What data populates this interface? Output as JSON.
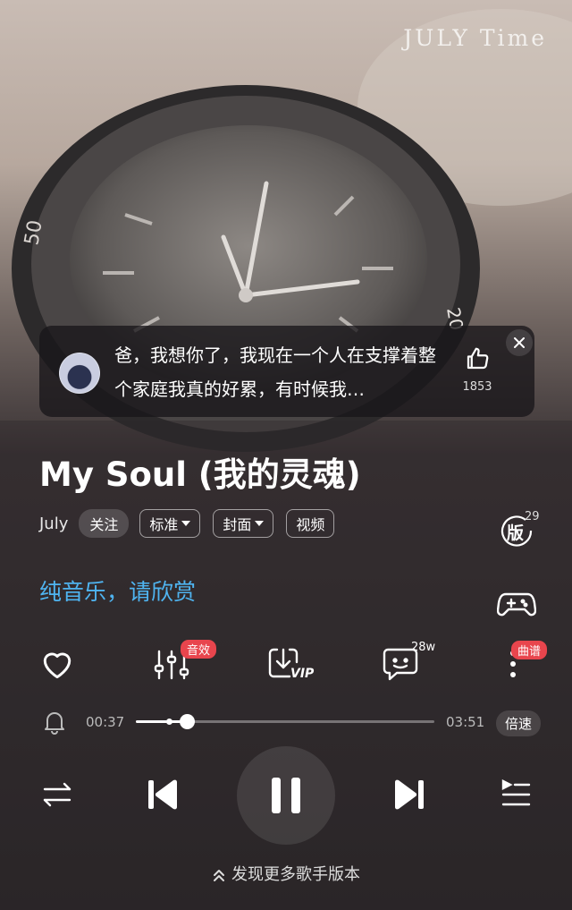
{
  "watermark": "JULY Time",
  "comment": {
    "text": "爸，我想你了，我现在一个人在支撑着整个家庭我真的好累，有时候我…",
    "like_count": "1853"
  },
  "song": {
    "title": "My Soul (我的灵魂)",
    "artist": "July",
    "follow_label": "关注",
    "chips": [
      "标准",
      "封面",
      "视频"
    ],
    "version_count": "29",
    "version_label": "版",
    "lyric": "纯音乐，请欣赏"
  },
  "actions": {
    "effects_badge": "音效",
    "comments_count": "28w",
    "score_badge": "曲谱",
    "vip_label": "VIP"
  },
  "progress": {
    "current": "00:37",
    "total": "03:51",
    "played_fraction": 0.17,
    "buffer_marker_fraction": 0.11,
    "speed_label": "倍速"
  },
  "footer": {
    "discover_label": "发现更多歌手版本"
  },
  "colors": {
    "lyric": "#4fb4f0",
    "badge": "#e8454d"
  }
}
